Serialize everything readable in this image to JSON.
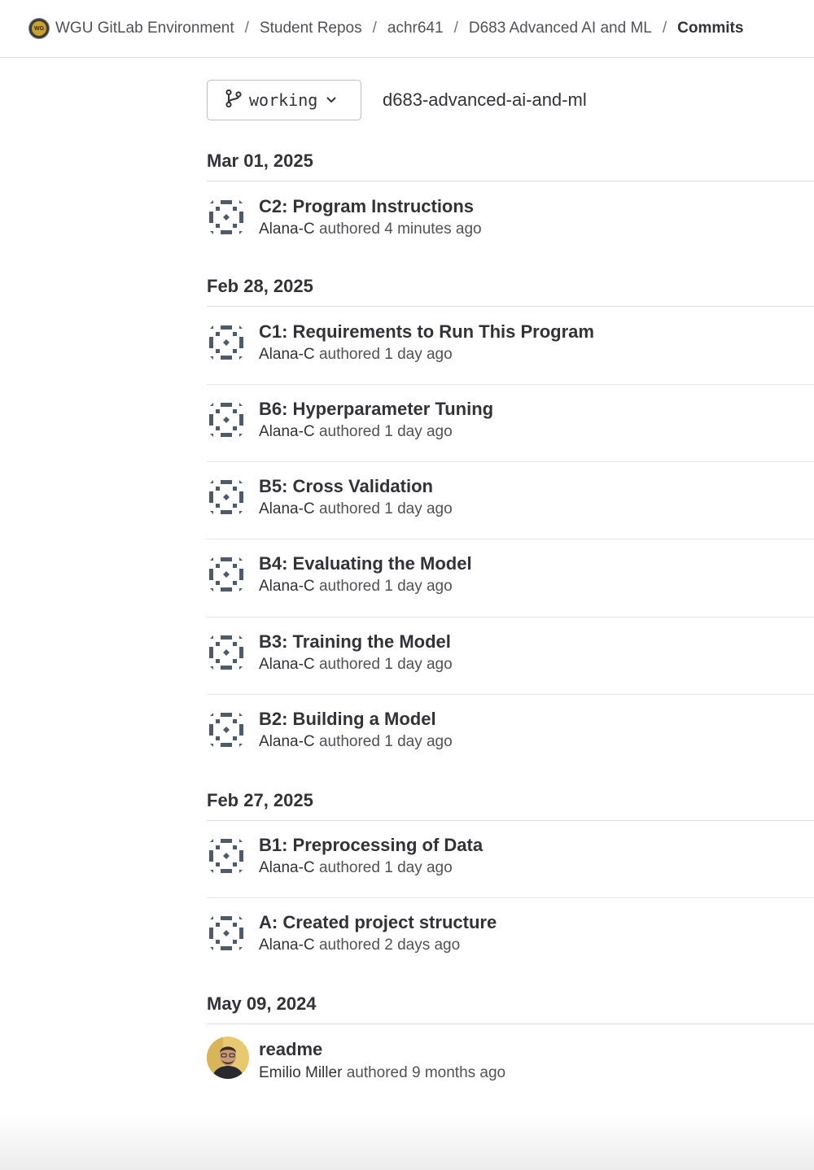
{
  "breadcrumb": {
    "logo_text": "WG",
    "items": [
      {
        "label": "WGU GitLab Environment"
      },
      {
        "label": "Student Repos"
      },
      {
        "label": "achr641"
      },
      {
        "label": "D683 Advanced AI and ML"
      },
      {
        "label": "Commits"
      }
    ],
    "separator": "/"
  },
  "branch": {
    "name": "working",
    "icon": "branch-icon",
    "repo_path": "d683-advanced-ai-and-ml"
  },
  "groups": [
    {
      "date": "Mar 01, 2025",
      "commits": [
        {
          "title": "C2: Program Instructions",
          "author": "Alana-C",
          "verb": "authored",
          "time": "4 minutes ago"
        }
      ]
    },
    {
      "date": "Feb 28, 2025",
      "commits": [
        {
          "title": "C1: Requirements to Run This Program",
          "author": "Alana-C",
          "verb": "authored",
          "time": "1 day ago"
        },
        {
          "title": "B6: Hyperparameter Tuning",
          "author": "Alana-C",
          "verb": "authored",
          "time": "1 day ago"
        },
        {
          "title": "B5: Cross Validation",
          "author": "Alana-C",
          "verb": "authored",
          "time": "1 day ago"
        },
        {
          "title": "B4: Evaluating the Model",
          "author": "Alana-C",
          "verb": "authored",
          "time": "1 day ago"
        },
        {
          "title": "B3: Training the Model",
          "author": "Alana-C",
          "verb": "authored",
          "time": "1 day ago"
        },
        {
          "title": "B2: Building a Model",
          "author": "Alana-C",
          "verb": "authored",
          "time": "1 day ago"
        }
      ]
    },
    {
      "date": "Feb 27, 2025",
      "commits": [
        {
          "title": "B1: Preprocessing of Data",
          "author": "Alana-C",
          "verb": "authored",
          "time": "1 day ago"
        },
        {
          "title": "A: Created project structure",
          "author": "Alana-C",
          "verb": "authored",
          "time": "2 days ago"
        }
      ]
    },
    {
      "date": "May 09, 2024",
      "commits": [
        {
          "title": "readme",
          "author": "Emilio Miller",
          "verb": "authored",
          "time": "9 months ago",
          "avatar": "photo"
        }
      ]
    }
  ],
  "colors": {
    "identicon": "#4f5a6b",
    "text": "#333238",
    "muted": "#535158",
    "divider": "#dcdcde"
  }
}
